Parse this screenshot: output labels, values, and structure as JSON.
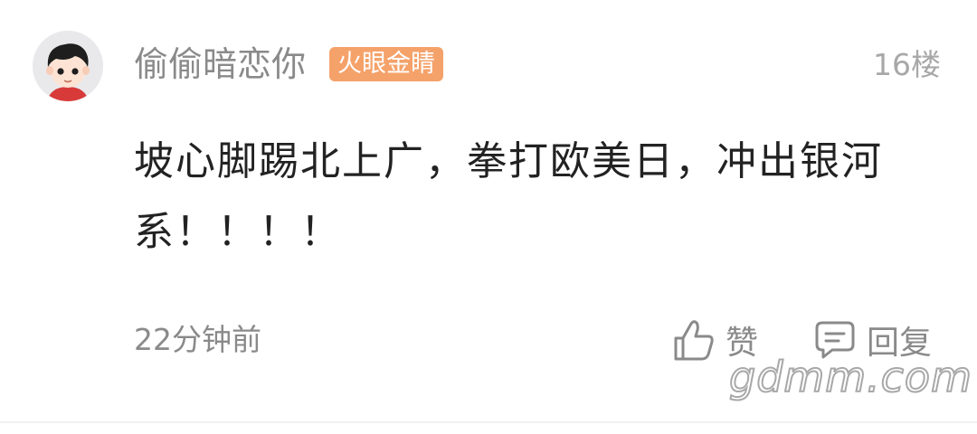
{
  "comment": {
    "username": "偷偷暗恋你",
    "badge": "火眼金睛",
    "floor": "16楼",
    "content": "坡心脚踢北上广，拳打欧美日，冲出银河系！！！！",
    "time": "22分钟前",
    "like_label": "赞",
    "reply_label": "回复"
  },
  "watermark": "gdmm.com",
  "colors": {
    "badge_bg": "#f5a26a",
    "secondary_text": "#8a8a8a",
    "primary_text": "#222222"
  }
}
